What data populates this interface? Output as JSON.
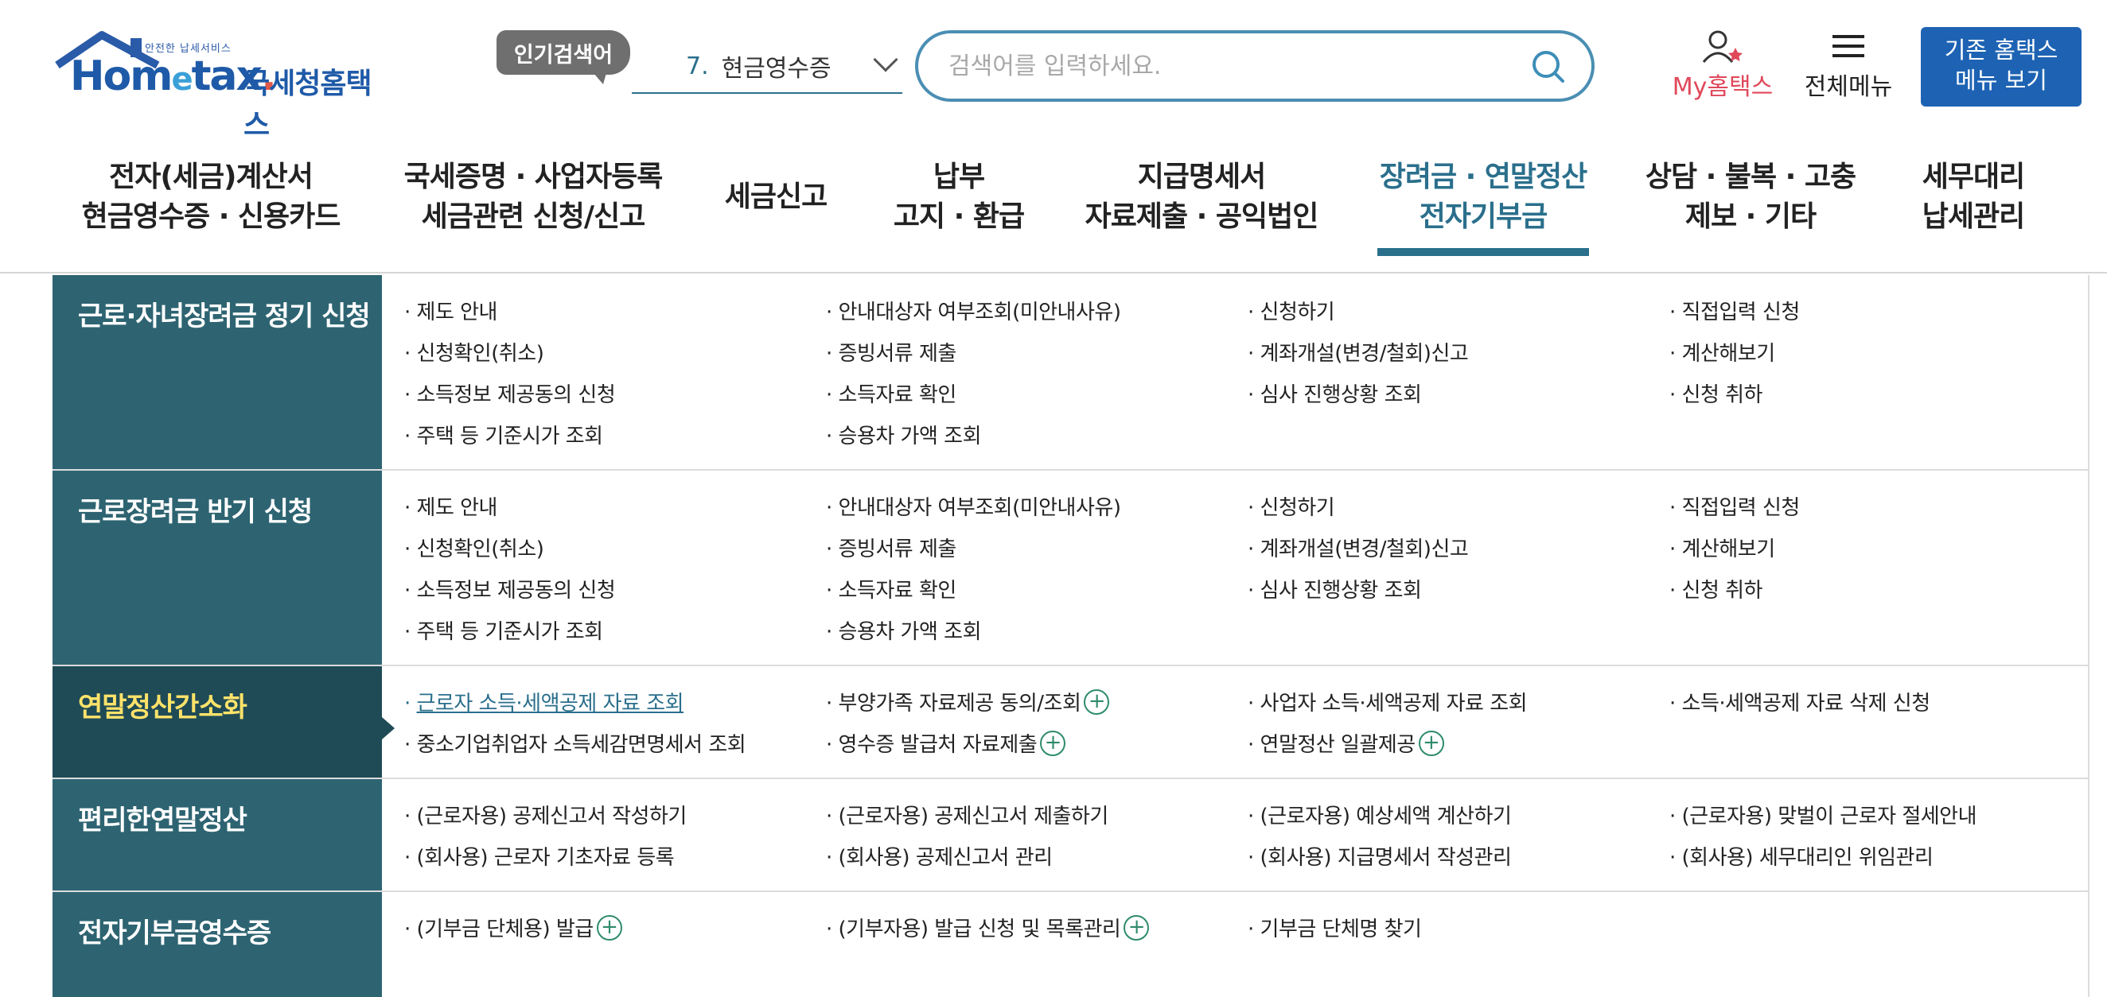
{
  "logo": {
    "tagline": "안전한 납세서비스",
    "word_a": "Hom",
    "word_e": "e",
    "word_b": "tax",
    "word_dot": ".",
    "korean": "국세청홈택스"
  },
  "popular_search": {
    "tag": "인기검색어",
    "rank": "7.",
    "term": "현금영수증"
  },
  "search": {
    "placeholder": "검색어를 입력하세요.",
    "value": ""
  },
  "utility": {
    "my_hometax": "My홈택스",
    "all_menu": "전체메뉴",
    "legacy_line1": "기존 홈택스",
    "legacy_line2": "메뉴 보기"
  },
  "gnb": [
    {
      "line1": "전자(세금)계산서",
      "line2": "현금영수증 · 신용카드",
      "active": false
    },
    {
      "line1": "국세증명 · 사업자등록",
      "line2": "세금관련 신청/신고",
      "active": false
    },
    {
      "line1": "세금신고",
      "line2": "",
      "active": false
    },
    {
      "line1": "납부",
      "line2": "고지 · 환급",
      "active": false
    },
    {
      "line1": "지급명세서",
      "line2": "자료제출 · 공익법인",
      "active": false
    },
    {
      "line1": "장려금 · 연말정산",
      "line2": "전자기부금",
      "active": true
    },
    {
      "line1": "상담 · 불복 · 고충",
      "line2": "제보 · 기타",
      "active": false
    },
    {
      "line1": "세무대리",
      "line2": "납세관리",
      "active": false
    }
  ],
  "sections": [
    {
      "title": "근로·자녀장려금 정기 신청",
      "links": [
        [
          "제도 안내",
          "안내대상자 여부조회(미안내사유)",
          "신청하기",
          "직접입력 신청"
        ],
        [
          "신청확인(취소)",
          "증빙서류 제출",
          "계좌개설(변경/철회)신고",
          "계산해보기"
        ],
        [
          "소득정보 제공동의 신청",
          "소득자료 확인",
          "심사 진행상황 조회",
          "신청 취하"
        ],
        [
          "주택 등 기준시가 조회",
          "승용차 가액 조회"
        ]
      ]
    },
    {
      "title": "근로장려금 반기 신청",
      "links": [
        [
          "제도 안내",
          "안내대상자 여부조회(미안내사유)",
          "신청하기",
          "직접입력 신청"
        ],
        [
          "신청확인(취소)",
          "증빙서류 제출",
          "계좌개설(변경/철회)신고",
          "계산해보기"
        ],
        [
          "소득정보 제공동의 신청",
          "소득자료 확인",
          "심사 진행상황 조회",
          "신청 취하"
        ],
        [
          "주택 등 기준시가 조회",
          "승용차 가액 조회"
        ]
      ]
    },
    {
      "title": "연말정산간소화",
      "links": [
        [
          "근로자 소득·세액공제 자료 조회",
          "부양가족 자료제공 동의/조회",
          "사업자 소득·세액공제 자료 조회",
          "소득·세액공제 자료 삭제 신청"
        ],
        [
          "중소기업취업자 소득세감면명세서 조회",
          "영수증 발급처 자료제출",
          "연말정산 일괄제공"
        ]
      ]
    },
    {
      "title": "편리한연말정산",
      "links": [
        [
          "(근로자용) 공제신고서 작성하기",
          "(근로자용) 공제신고서 제출하기",
          "(근로자용) 예상세액 계산하기",
          "(근로자용) 맞벌이 근로자 절세안내"
        ],
        [
          "(회사용) 근로자 기초자료 등록",
          "(회사용) 공제신고서 관리",
          "(회사용) 지급명세서 작성관리",
          "(회사용) 세무대리인 위임관리"
        ]
      ]
    },
    {
      "title": "전자기부금영수증",
      "links": [
        [
          "(기부금 단체용) 발급",
          "(기부자용) 발급 신청 및 목록관리",
          "기부금 단체명 찾기"
        ]
      ]
    }
  ],
  "plus_symbol": "+"
}
